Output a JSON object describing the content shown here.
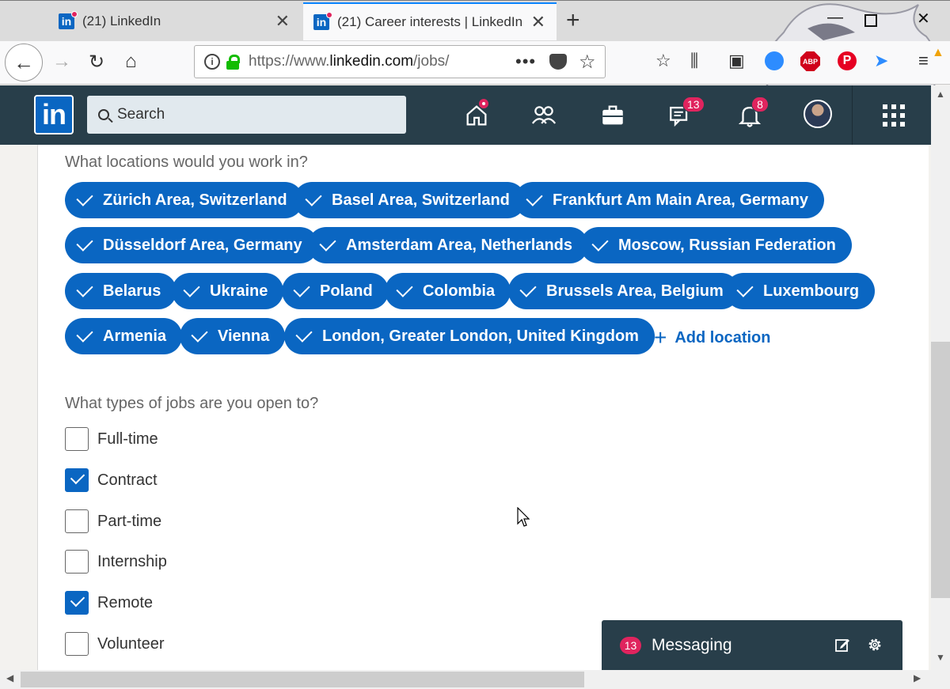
{
  "browser": {
    "tabs": [
      {
        "title": "(21) LinkedIn",
        "active": false
      },
      {
        "title": "(21) Career interests | LinkedIn",
        "active": true
      }
    ],
    "url_scheme": "https://www.",
    "url_host": "linkedin.com",
    "url_path": "/jobs/"
  },
  "linkedin": {
    "logo": "in",
    "search_placeholder": "Search",
    "messages_badge": "13",
    "notifications_badge": "8",
    "icons": [
      "home-icon",
      "my-network-icon",
      "jobs-icon",
      "messaging-icon",
      "notifications-icon",
      "work-grid-icon"
    ]
  },
  "locations": {
    "question": "What locations would you work in?",
    "items": [
      "Zürich Area, Switzerland",
      "Basel Area, Switzerland",
      "Frankfurt Am Main Area, Germany",
      "Düsseldorf Area, Germany",
      "Amsterdam Area, Netherlands",
      "Moscow, Russian Federation",
      "Belarus",
      "Ukraine",
      "Poland",
      "Colombia",
      "Brussels Area, Belgium",
      "Luxembourg",
      "Armenia",
      "Vienna",
      "London, Greater London, United Kingdom"
    ],
    "add_label": "Add location"
  },
  "job_types": {
    "question": "What types of jobs are you open to?",
    "options": [
      {
        "label": "Full-time",
        "checked": false
      },
      {
        "label": "Contract",
        "checked": true
      },
      {
        "label": "Part-time",
        "checked": false
      },
      {
        "label": "Internship",
        "checked": false
      },
      {
        "label": "Remote",
        "checked": true
      },
      {
        "label": "Volunteer",
        "checked": false
      }
    ]
  },
  "messaging": {
    "badge": "13",
    "title": "Messaging"
  },
  "colors": {
    "brand_blue": "#0a66c2",
    "header_dark": "#283e4a",
    "badge_red": "#e0245e"
  }
}
